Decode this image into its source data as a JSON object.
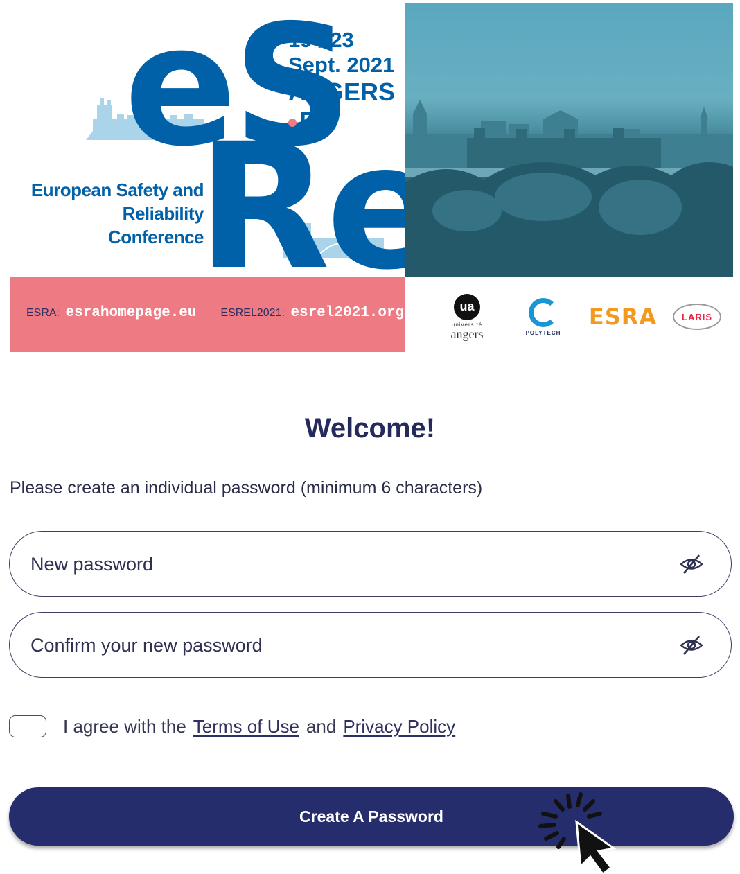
{
  "banner": {
    "logo_es": "eS",
    "logo_rel": "Rel",
    "dates_line1": "19 / 23",
    "dates_line2": "Sept. 2021",
    "city": "ANGERS",
    "country": "FR",
    "conference_line1": "European Safety and",
    "conference_line2": "Reliability Conference",
    "esra_label": "ESRA:",
    "esra_link": "esrahomepage.eu",
    "esrel_label": "ESREL2021:",
    "esrel_link": "esrel2021.org",
    "partners": {
      "angers_mark": "ua",
      "angers_small": "université",
      "angers_name": "angers",
      "polytech": "POLYTECH",
      "esra": "ESRA",
      "laris": "LARIS"
    }
  },
  "form": {
    "title": "Welcome!",
    "instructions": "Please create an individual password (minimum 6 characters)",
    "new_password_placeholder": "New password",
    "confirm_password_placeholder": "Confirm your new password",
    "agree_prefix": "I agree with the",
    "terms_link": "Terms of Use",
    "and_text": "and",
    "privacy_link": "Privacy Policy",
    "submit_label": "Create A Password"
  },
  "icons": {
    "visibility_toggle": "eye-slash-icon",
    "cursor": "click-cursor-icon"
  },
  "colors": {
    "primary": "#262d6d",
    "logo_blue": "#0060a8",
    "banner_pink": "#ee7b83",
    "esra_orange": "#f29a1f"
  }
}
